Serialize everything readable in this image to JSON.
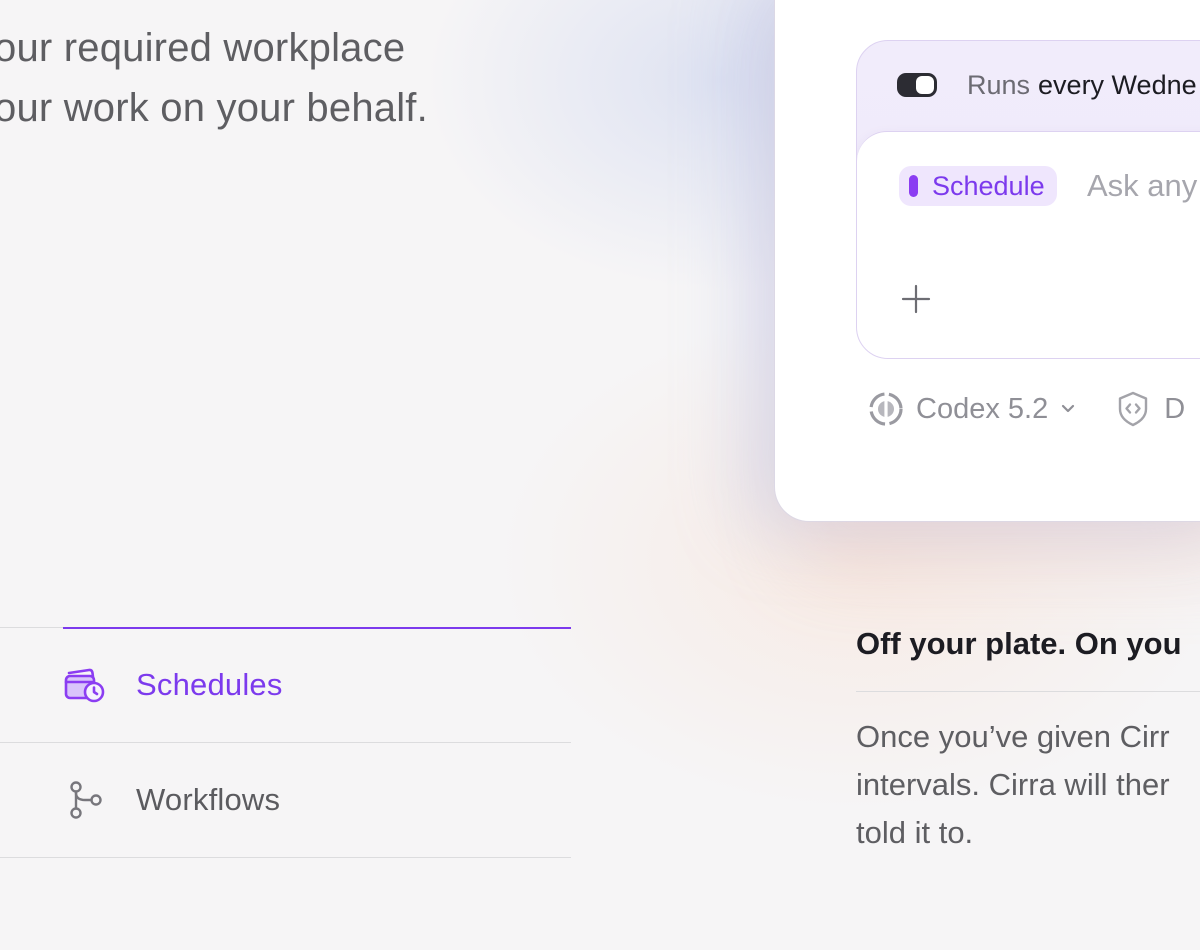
{
  "intro": {
    "line1": "our required workplace",
    "line2": "our work on your behalf."
  },
  "features": {
    "items": [
      {
        "label": "Schedules",
        "icon": "calendar-clock-icon",
        "active": true
      },
      {
        "label": "Workflows",
        "icon": "branch-icon",
        "active": false
      }
    ]
  },
  "composer": {
    "runs_prefix": "Runs",
    "runs_value": "every Wedne",
    "chip_label": "Schedule",
    "placeholder": "Ask any",
    "plus_icon": "plus-icon",
    "model_label": "Codex 5.2",
    "model_icon": "codex-logo-icon",
    "secondary_label": "D",
    "secondary_icon": "shield-code-icon"
  },
  "description": {
    "title": "Off your plate. On you",
    "line1": "Once you’ve given Cirr",
    "line2": "intervals. Cirra will ther",
    "line3": "told it to."
  },
  "colors": {
    "accent": "#7c3aed",
    "toggle_on": "#2c2c33",
    "chip_bg": "#efe6fd"
  }
}
